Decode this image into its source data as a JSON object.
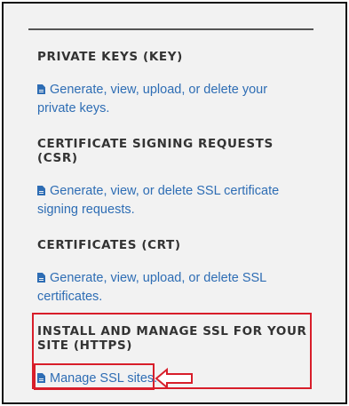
{
  "sections": [
    {
      "heading": "PRIVATE KEYS (KEY)",
      "link": "Generate, view, upload, or delete your private keys."
    },
    {
      "heading": "CERTIFICATE SIGNING REQUESTS (CSR)",
      "link": "Generate, view, or delete SSL certificate signing requests."
    },
    {
      "heading": "CERTIFICATES (CRT)",
      "link": "Generate, view, upload, or delete SSL certificates."
    },
    {
      "heading": "INSTALL AND MANAGE SSL FOR YOUR SITE (HTTPS)",
      "link": "Manage SSL sites."
    }
  ],
  "icons": {
    "link_icon": "document-icon",
    "pointer": "left-arrow-icon"
  },
  "colors": {
    "link": "#2e6db4",
    "highlight": "#d81e2a"
  }
}
